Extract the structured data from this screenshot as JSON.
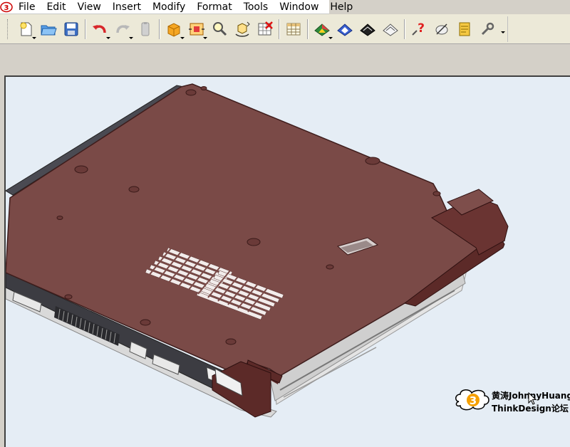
{
  "window": {
    "app_icon": "app-logo-icon"
  },
  "menubar": {
    "items": [
      {
        "label": "File"
      },
      {
        "label": "Edit"
      },
      {
        "label": "View"
      },
      {
        "label": "Insert"
      },
      {
        "label": "Modify"
      },
      {
        "label": "Format"
      },
      {
        "label": "Tools"
      },
      {
        "label": "Window"
      },
      {
        "label": "Help"
      }
    ]
  },
  "toolbar": {
    "buttons": [
      {
        "icon": "new-document-icon"
      },
      {
        "icon": "open-folder-icon"
      },
      {
        "icon": "save-disk-icon"
      },
      {
        "icon": "undo-icon"
      },
      {
        "icon": "redo-icon"
      },
      {
        "icon": "clipboard-icon"
      },
      {
        "icon": "solid-box-icon"
      },
      {
        "icon": "fit-view-icon"
      },
      {
        "icon": "zoom-icon"
      },
      {
        "icon": "rotate-view-icon"
      },
      {
        "icon": "grid-delete-icon"
      },
      {
        "icon": "table-icon"
      },
      {
        "icon": "shaded-render-icon"
      },
      {
        "icon": "wireframe-render-icon"
      },
      {
        "icon": "hidden-line-icon"
      },
      {
        "icon": "section-view-icon"
      },
      {
        "icon": "help-question-icon"
      },
      {
        "icon": "measure-icon"
      },
      {
        "icon": "notes-icon"
      },
      {
        "icon": "settings-wrench-icon"
      }
    ]
  },
  "watermark": {
    "line1": "黄涛JohnnyHuang",
    "line2": "ThinkDesign论坛",
    "logo_digit": "3"
  },
  "colors": {
    "model_top": "#7a4a47",
    "model_side": "#5c2a28",
    "inner_frame": "#d8d8d8",
    "viewport_bg": "#e5edf5"
  }
}
